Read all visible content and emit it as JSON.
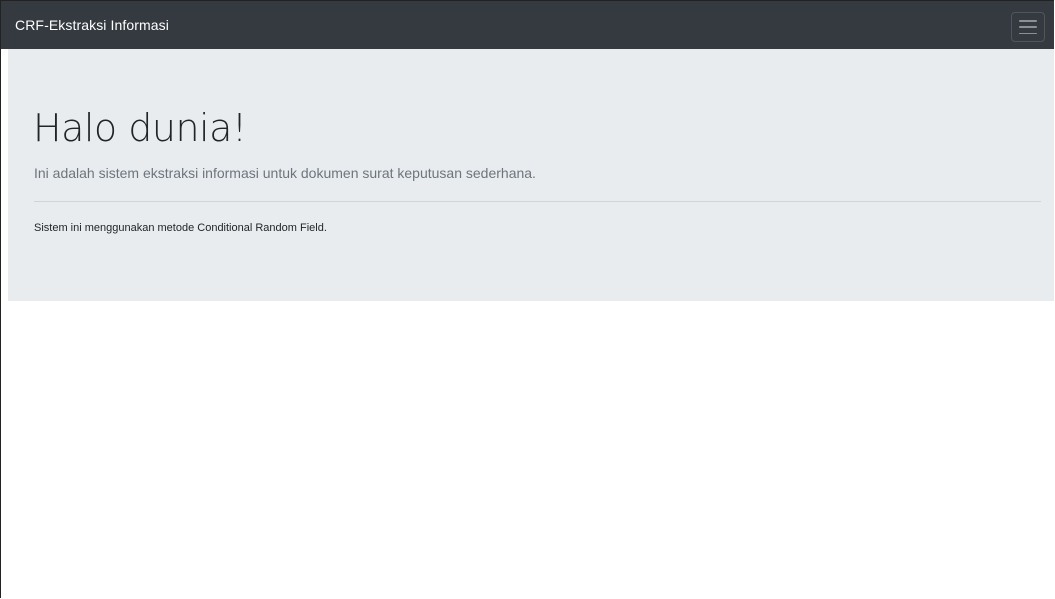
{
  "navbar": {
    "brand": "CRF-Ekstraksi Informasi",
    "toggler_icon": "hamburger-menu-icon",
    "background": "#343a40"
  },
  "jumbotron": {
    "title": "Halo dunia!",
    "lead": "Ini adalah sistem ekstraksi informasi untuk dokumen surat keputusan sederhana.",
    "text": "Sistem ini menggunakan metode Conditional Random Field.",
    "background": "#e9ecef"
  }
}
